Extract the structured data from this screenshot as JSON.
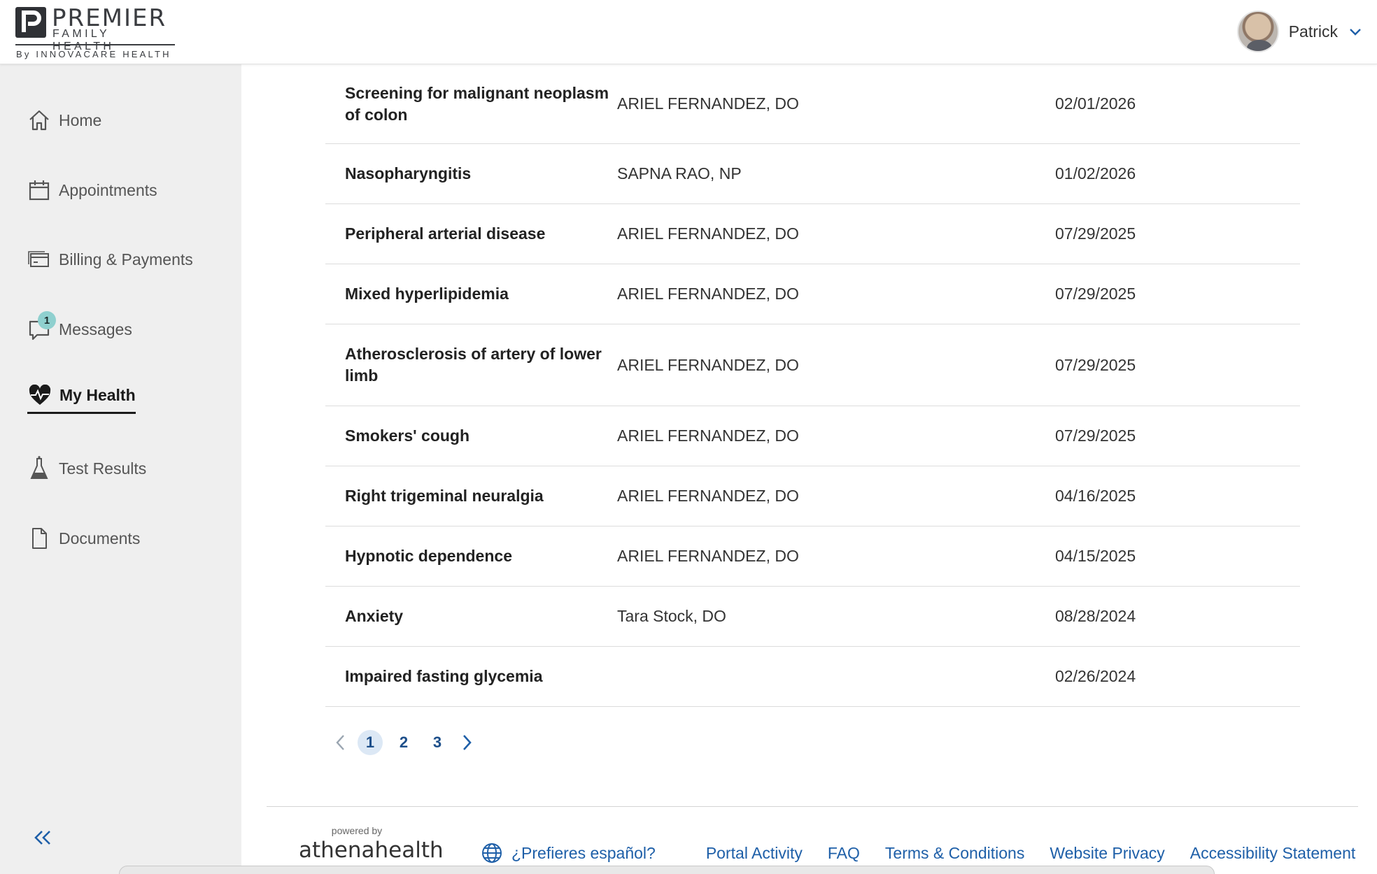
{
  "header": {
    "logo_premier": "PREMIER",
    "logo_family": "FAMILY HEALTH",
    "logo_by": "By INNOVACARE HEALTH",
    "user_name": "Patrick"
  },
  "sidebar": {
    "items": [
      {
        "label": "Home",
        "icon": "home-icon"
      },
      {
        "label": "Appointments",
        "icon": "calendar-icon"
      },
      {
        "label": "Billing & Payments",
        "icon": "billing-icon"
      },
      {
        "label": "Messages",
        "icon": "message-icon",
        "badge": "1"
      },
      {
        "label": "My Health",
        "icon": "heart-pulse-icon",
        "active": true
      },
      {
        "label": "Test Results",
        "icon": "flask-icon"
      },
      {
        "label": "Documents",
        "icon": "document-icon"
      }
    ]
  },
  "conditions": {
    "rows": [
      {
        "name": "Screening for malignant neoplasm of colon",
        "provider": "ARIEL FERNANDEZ, DO",
        "date": "02/01/2026"
      },
      {
        "name": "Nasopharyngitis",
        "provider": "SAPNA RAO, NP",
        "date": "01/02/2026"
      },
      {
        "name": "Peripheral arterial disease",
        "provider": "ARIEL FERNANDEZ, DO",
        "date": "07/29/2025"
      },
      {
        "name": "Mixed hyperlipidemia",
        "provider": "ARIEL FERNANDEZ, DO",
        "date": "07/29/2025"
      },
      {
        "name": "Atherosclerosis of artery of lower limb",
        "provider": "ARIEL FERNANDEZ, DO",
        "date": "07/29/2025"
      },
      {
        "name": "Smokers' cough",
        "provider": "ARIEL FERNANDEZ, DO",
        "date": "07/29/2025"
      },
      {
        "name": "Right trigeminal neuralgia",
        "provider": "ARIEL FERNANDEZ, DO",
        "date": "04/16/2025"
      },
      {
        "name": "Hypnotic dependence",
        "provider": "ARIEL FERNANDEZ, DO",
        "date": "04/15/2025"
      },
      {
        "name": "Anxiety",
        "provider": "Tara Stock, DO",
        "date": "08/28/2024"
      },
      {
        "name": "Impaired fasting glycemia",
        "provider": "",
        "date": "02/26/2024"
      }
    ]
  },
  "pagination": {
    "pages": [
      "1",
      "2",
      "3"
    ],
    "current": "1"
  },
  "footer": {
    "powered_by": "powered by",
    "brand": "athenahealth",
    "spanish": "¿Prefieres español?",
    "links": [
      "Portal Activity",
      "FAQ",
      "Terms & Conditions",
      "Website Privacy",
      "Accessibility Statement"
    ]
  },
  "colors": {
    "link": "#1e5fa8",
    "sidebar_bg": "#efefef",
    "badge": "#8fd0cf",
    "current_page_bg": "#dce8f5"
  }
}
